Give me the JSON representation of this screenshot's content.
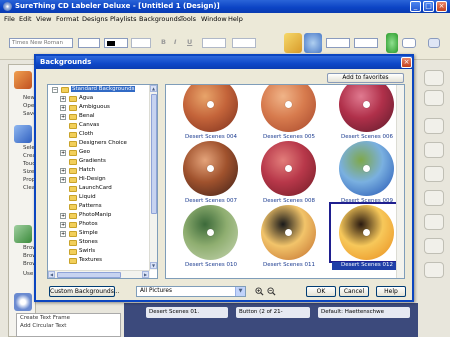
{
  "app": {
    "title": "SureThing CD Labeler Deluxe - [Untitled 1 (Design)]",
    "min_label": "_",
    "max_label": "□",
    "close_label": "×"
  },
  "menu": [
    "File",
    "Edit",
    "View",
    "Format",
    "Designs",
    "Playlists",
    "Backgrounds",
    "Tools",
    "Window",
    "Help"
  ],
  "toolbar": {
    "font_name": "Times New Roman",
    "bold": "B",
    "italic": "I",
    "underline": "U"
  },
  "left_panel": {
    "labels": [
      "New",
      "Open",
      "Save",
      "Select",
      "Creat",
      "Touc",
      "Size",
      "Prope",
      "Clear",
      "Brow",
      "Brow",
      "Brow",
      "Use I"
    ]
  },
  "create_list": [
    "Create Text Frame",
    "Add Circular Text"
  ],
  "bottom_strip": {
    "design": "Desert Scenes 01.",
    "button": "Button (2 of 21-",
    "default": "Default: Haettenschwe"
  },
  "dialog": {
    "title": "Backgrounds",
    "close_label": "×",
    "add_favorites": "Add to favorites",
    "tree": [
      {
        "label": "Standard Backgrounds",
        "level": 0,
        "expander": "−",
        "selected": true
      },
      {
        "label": "Agua",
        "level": 1,
        "expander": "+"
      },
      {
        "label": "Ambiguous",
        "level": 1,
        "expander": "+"
      },
      {
        "label": "Benal",
        "level": 1,
        "expander": "+"
      },
      {
        "label": "Canvas",
        "level": 1,
        "expander": ""
      },
      {
        "label": "Cloth",
        "level": 1,
        "expander": ""
      },
      {
        "label": "Designers Choice",
        "level": 1,
        "expander": ""
      },
      {
        "label": "Geo",
        "level": 1,
        "expander": "+"
      },
      {
        "label": "Gradients",
        "level": 1,
        "expander": ""
      },
      {
        "label": "Hatch",
        "level": 1,
        "expander": "+"
      },
      {
        "label": "Hi-Design",
        "level": 1,
        "expander": "+"
      },
      {
        "label": "LaunchCard",
        "level": 1,
        "expander": ""
      },
      {
        "label": "Liquid",
        "level": 1,
        "expander": ""
      },
      {
        "label": "Patterns",
        "level": 1,
        "expander": ""
      },
      {
        "label": "PhotoManip",
        "level": 1,
        "expander": "+"
      },
      {
        "label": "Photos",
        "level": 1,
        "expander": "+"
      },
      {
        "label": "Simple",
        "level": 1,
        "expander": "+"
      },
      {
        "label": "Stones",
        "level": 1,
        "expander": ""
      },
      {
        "label": "Swirls",
        "level": 1,
        "expander": ""
      },
      {
        "label": "Textures",
        "level": 1,
        "expander": ""
      }
    ],
    "thumbnails": [
      {
        "caption": "Desert Scenes 004",
        "colors": [
          "#7a2e1c",
          "#c4643a",
          "#e8a46a"
        ]
      },
      {
        "caption": "Desert Scenes 005",
        "colors": [
          "#a5452a",
          "#d77b4e",
          "#f0b488"
        ]
      },
      {
        "caption": "Desert Scenes 006",
        "colors": [
          "#5a1a2a",
          "#b0304a",
          "#e07a90"
        ]
      },
      {
        "caption": "Desert Scenes 007",
        "colors": [
          "#3c1e18",
          "#a0522d",
          "#e4a37a"
        ]
      },
      {
        "caption": "Desert Scenes 008",
        "colors": [
          "#6e1a24",
          "#b8384a",
          "#e27d7a"
        ]
      },
      {
        "caption": "Desert Scenes 009",
        "colors": [
          "#1e4fb0",
          "#7ab0e0",
          "#7fa84a"
        ]
      },
      {
        "caption": "Desert Scenes 010",
        "colors": [
          "#c8d6b4",
          "#8fae70",
          "#3c6a3a"
        ]
      },
      {
        "caption": "Desert Scenes 011",
        "colors": [
          "#c06a2a",
          "#f2c46a",
          "#1a1a1a"
        ]
      },
      {
        "caption": "Desert Scenes 012",
        "colors": [
          "#e88a1a",
          "#f7c85a",
          "#2a1a10"
        ],
        "selected": true
      }
    ],
    "custom_backgrounds": "Custom Backgrounds...",
    "filter": "All Pictures",
    "zoom_in_icon": "zoom-in-icon",
    "zoom_out_icon": "zoom-out-icon",
    "ok": "OK",
    "cancel": "Cancel",
    "help": "Help"
  }
}
